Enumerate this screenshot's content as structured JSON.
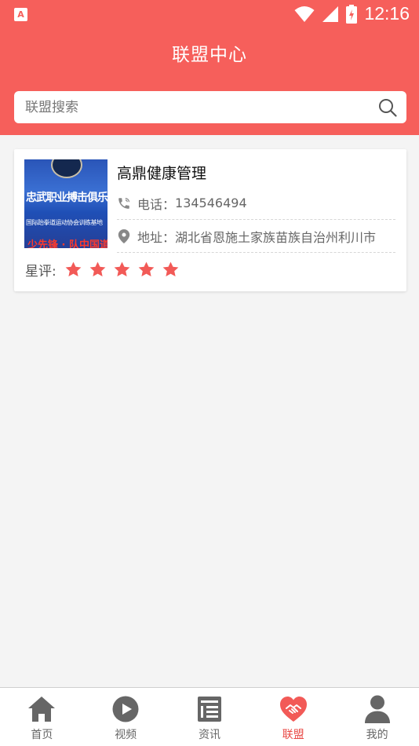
{
  "status_bar": {
    "app_icon": "A",
    "time": "12:16",
    "icons": [
      "wifi-icon",
      "signal-icon",
      "battery-icon"
    ]
  },
  "header": {
    "title": "联盟中心"
  },
  "search": {
    "placeholder": "联盟搜索",
    "value": ""
  },
  "listing": {
    "name": "高鼎健康管理",
    "phone_label": "电话：",
    "phone": "134546494",
    "address_label": "地址：",
    "address": "湖北省恩施土家族苗族自治州利川市",
    "rating_label": "星评:",
    "stars": 5,
    "thumbnail_text": [
      "忠武职业搏击俱乐部",
      "国际跆拳道运动协会训练基地",
      "少先锋 · 队中国道"
    ]
  },
  "tabbar": {
    "items": [
      {
        "label": "首页",
        "icon": "home-icon",
        "active": false
      },
      {
        "label": "视频",
        "icon": "video-play-icon",
        "active": false
      },
      {
        "label": "资讯",
        "icon": "news-icon",
        "active": false
      },
      {
        "label": "联盟",
        "icon": "handshake-heart-icon",
        "active": true
      },
      {
        "label": "我的",
        "icon": "user-icon",
        "active": false
      }
    ]
  },
  "colors": {
    "brand": "#f65f5b",
    "star": "#f25a57",
    "tab_active": "#e94a46",
    "tab_inactive": "#666666"
  }
}
